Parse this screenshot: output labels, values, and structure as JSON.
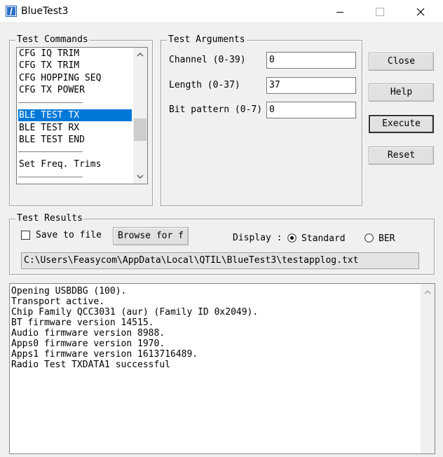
{
  "window": {
    "title": "BlueTest3",
    "min_icon": "minimize-icon",
    "max_icon": "maximize-icon",
    "close_icon": "close-icon"
  },
  "test_commands": {
    "legend": "Test Commands",
    "items": [
      "CFG IQ TRIM",
      "CFG TX TRIM",
      "CFG HOPPING SEQ",
      "CFG TX POWER",
      "BLE TEST TX",
      "BLE TEST RX",
      "BLE TEST END",
      "Set Freq. Trims"
    ],
    "selected": "BLE TEST TX"
  },
  "test_arguments": {
    "legend": "Test Arguments",
    "channel_label": "Channel (0-39)",
    "channel_value": "0",
    "length_label": "Length (0-37)",
    "length_value": "37",
    "bitpattern_label": "Bit pattern (0-7)",
    "bitpattern_value": "0"
  },
  "buttons": {
    "close": "Close",
    "help": "Help",
    "execute": "Execute",
    "reset": "Reset"
  },
  "test_results": {
    "legend": "Test Results",
    "save_to_file": "Save to file",
    "save_checked": false,
    "browse": "Browse for f",
    "display_label": "Display :",
    "standard": "Standard",
    "ber": "BER",
    "selected_display": "Standard",
    "path": "C:\\Users\\Feasycom\\AppData\\Local\\QTIL\\BlueTest3\\testapplog.txt"
  },
  "output_lines": [
    "Opening USBDBG (100).",
    "Transport active.",
    "Chip Family QCC3031 (aur) (Family ID 0x2049).",
    "BT firmware version 14515.",
    "Audio firmware version 8988.",
    "Apps0 firmware version 1970.",
    "Apps1 firmware version 1613716489.",
    "Radio Test TXDATA1 successful"
  ],
  "colors": {
    "selection": "#0078d7",
    "window_bg": "#f0f0f0"
  }
}
